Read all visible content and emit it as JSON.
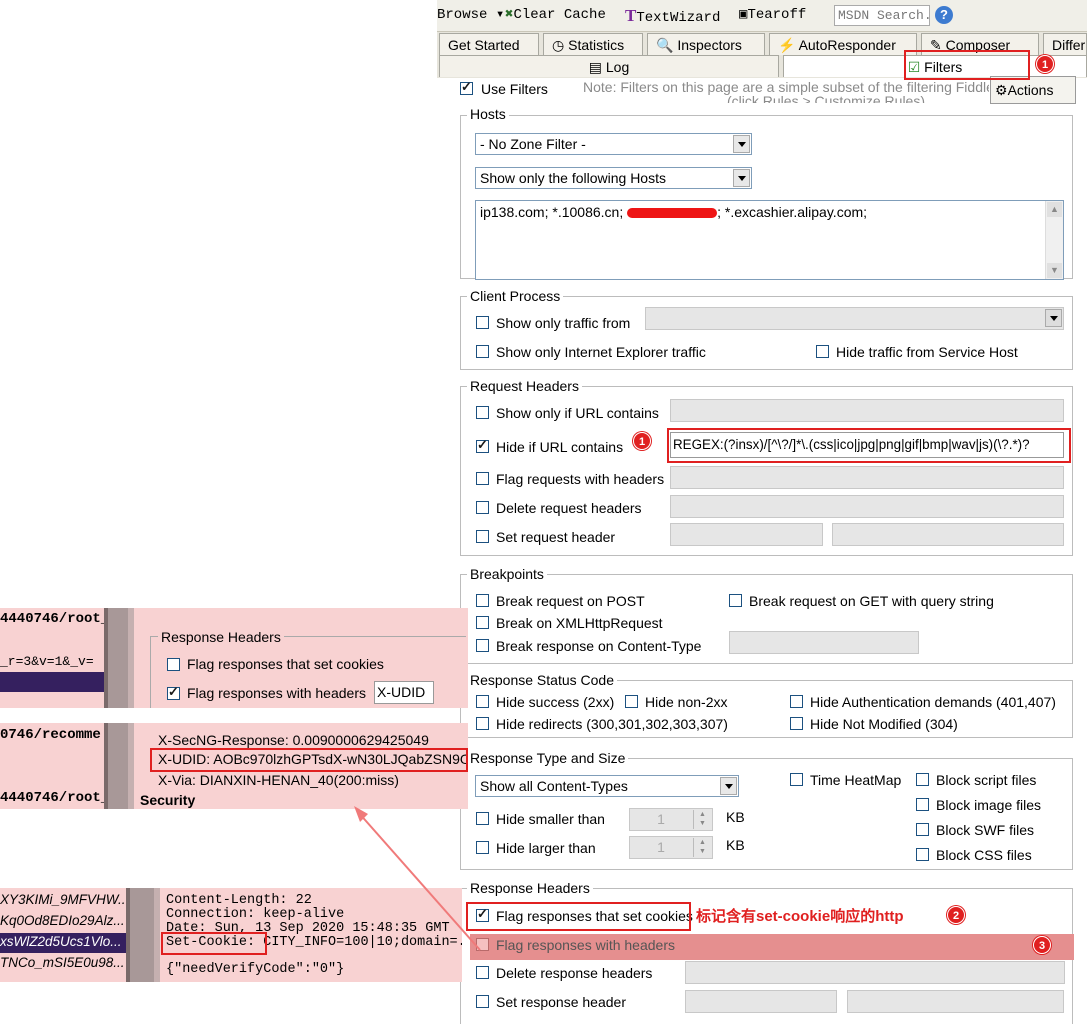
{
  "toolbar": {
    "browse": "Browse",
    "clear_cache": "Clear Cache",
    "textwizard": "TextWizard",
    "tearoff": "Tearoff",
    "search_placeholder": "MSDN Search..."
  },
  "tabs": {
    "row1": [
      "Get Started",
      "Statistics",
      "Inspectors",
      "AutoResponder",
      "Composer",
      "Differ"
    ],
    "log": "Log",
    "filters": "Filters"
  },
  "filters": {
    "use_filters": "Use Filters",
    "note_line1": "Note: Filters on this page are a simple subset of the filtering Fiddle",
    "note_line2": "(click Rules > Customize Rules)",
    "actions": "Actions",
    "hosts": {
      "title": "Hosts",
      "zone_filter": "- No Zone Filter -",
      "host_filter": "Show only the following Hosts",
      "host_list_visible_a": "ip138.com; *.10086.cn; ",
      "host_list_visible_b": "; *.excashier.alipay.com;"
    },
    "client_process": {
      "title": "Client Process",
      "traffic_from": "Show only traffic from",
      "ie_traffic": "Show only Internet Explorer traffic",
      "hide_service_host": "Hide traffic from Service Host"
    },
    "request_headers": {
      "title": "Request Headers",
      "show_url": "Show only if URL contains",
      "hide_url": "Hide if URL contains",
      "hide_url_value": "REGEX:(?insx)/[^\\?/]*\\.(css|ico|jpg|png|gif|bmp|wav|js)(\\?.*)?",
      "flag_requests": "Flag requests with headers",
      "delete_requests": "Delete request headers",
      "set_request": "Set request header"
    },
    "breakpoints": {
      "title": "Breakpoints",
      "post": "Break request on POST",
      "get": "Break request on GET with query string",
      "xml": "Break on XMLHttpRequest",
      "content_type": "Break response on Content-Type"
    },
    "response_status": {
      "title": "Response Status Code",
      "success": "Hide success (2xx)",
      "non2xx": "Hide non-2xx",
      "auth": "Hide Authentication demands (401,407)",
      "redirects": "Hide redirects (300,301,302,303,307)",
      "not_modified": "Hide Not Modified (304)"
    },
    "response_type": {
      "title": "Response Type and Size",
      "content_types": "Show all Content-Types",
      "time_heatmap": "Time HeatMap",
      "block_script": "Block script files",
      "block_image": "Block image files",
      "block_swf": "Block SWF files",
      "block_css": "Block CSS files",
      "hide_smaller": "Hide smaller than",
      "hide_larger": "Hide larger than",
      "size_value": "1",
      "kb": "KB"
    },
    "response_headers": {
      "title": "Response Headers",
      "flag_cookies": "Flag responses that set cookies",
      "flag_headers": "Flag responses with headers",
      "delete_headers": "Delete response headers",
      "set_header": "Set response header"
    }
  },
  "annotations": {
    "n1": "1",
    "n2": "2",
    "n3": "3",
    "cookie_note": "标记含有set-cookie响应的http"
  },
  "left_top": {
    "row1": "4440746/root_",
    "row2": "_r=3&v=1&_v=",
    "resp_title": "Response Headers",
    "flag_cookies": "Flag responses that set cookies",
    "flag_headers": "Flag responses with headers",
    "xudid": "X-UDID"
  },
  "left_mid": {
    "row1": "0746/recomme",
    "row2": "4440746/root_",
    "secng": "X-SecNG-Response: 0.0090000629425049",
    "udid": "X-UDID: AOBc970lzhGPTsdX-wN30LJQabZSN9OK",
    "via": "X-Via: DIANXIN-HENAN_40(200:miss)",
    "security": "Security"
  },
  "left_bottom": {
    "rows": [
      "XY3KIMi_9MFVHW...",
      "Kq0Od8EDIo29Alz...",
      "xsWlZ2d5Ucs1Vlo...",
      "TNCo_mSI5E0u98..."
    ],
    "content_length": "Content-Length: 22",
    "connection": "Connection: keep-alive",
    "date": "Date: Sun, 13 Sep 2020 15:48:35 GMT",
    "set_cookie_key": "Set-Cookie:",
    "set_cookie_val": " CITY_INFO=100|10;domain=.",
    "body": "{\"needVerifyCode\":\"0\"}"
  },
  "colors": {
    "accent_red": "#e02020",
    "pink_bg": "#f8d2d2",
    "row_highlight": "#35205f"
  }
}
